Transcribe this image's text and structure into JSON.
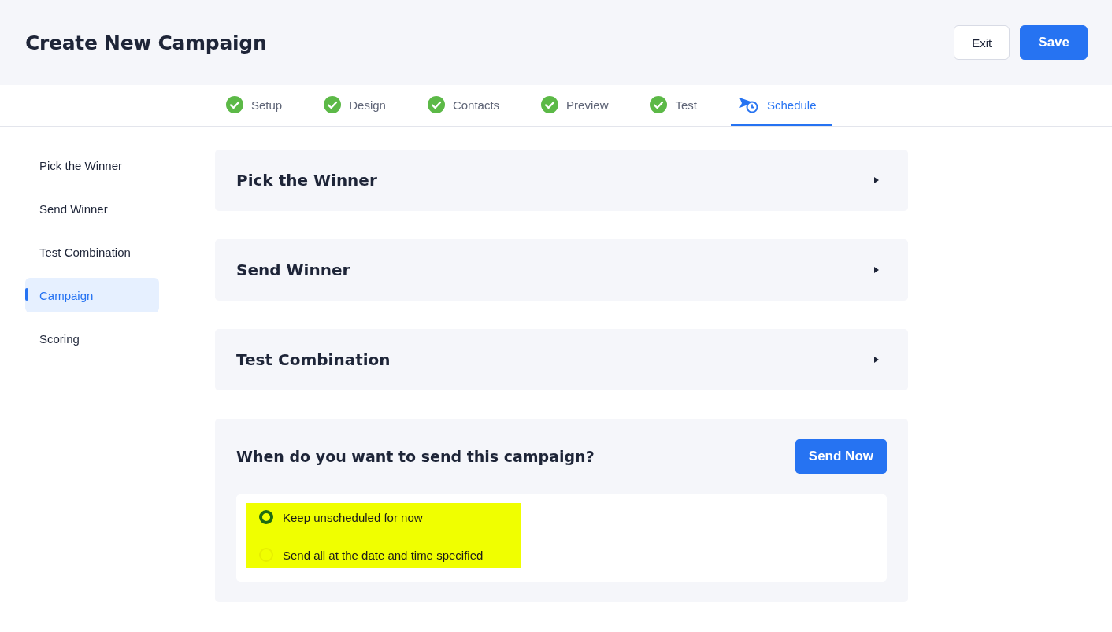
{
  "header": {
    "title": "Create New Campaign",
    "buttons": [
      {
        "label": "Exit",
        "kind": "secondary"
      },
      {
        "label": "Save",
        "kind": "primary"
      }
    ]
  },
  "steps": [
    {
      "label": "Setup",
      "completed": true,
      "selected": false
    },
    {
      "label": "Design",
      "completed": true,
      "selected": false
    },
    {
      "label": "Contacts",
      "completed": true,
      "selected": false
    },
    {
      "label": "Preview",
      "completed": true,
      "selected": false
    },
    {
      "label": "Test",
      "completed": true,
      "selected": false
    },
    {
      "label": "Schedule",
      "completed": false,
      "selected": true
    }
  ],
  "sidebar": {
    "items": [
      {
        "label": "Pick the Winner",
        "selected": false
      },
      {
        "label": "Send Winner",
        "selected": false
      },
      {
        "label": "Test Combination",
        "selected": false
      },
      {
        "label": "Campaign",
        "selected": true
      },
      {
        "label": "Scoring",
        "selected": false
      }
    ]
  },
  "sections": [
    {
      "title": "Pick the Winner",
      "expanded": false
    },
    {
      "title": "Send Winner",
      "expanded": false
    },
    {
      "title": "Test Combination",
      "expanded": false
    }
  ],
  "schedule": {
    "question": "When do you want to send this campaign?",
    "button": "Send Now",
    "options": [
      {
        "label": "Keep unscheduled for now",
        "selected": true
      },
      {
        "label": "Send all at the date and time specified",
        "selected": false
      }
    ]
  }
}
